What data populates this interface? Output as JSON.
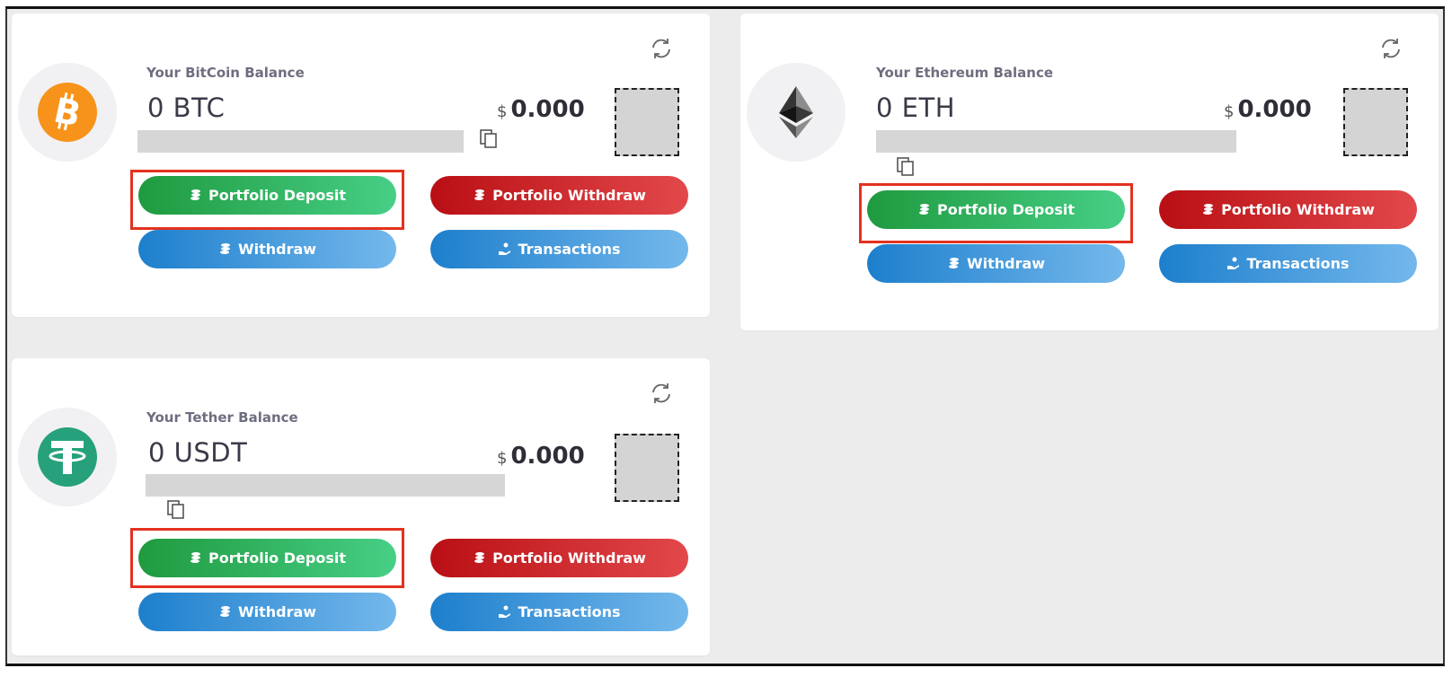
{
  "cards": [
    {
      "coin": "bitcoin",
      "title": "Your BitCoin Balance",
      "amount": "0 BTC",
      "currency_symbol": "$",
      "usd_value": "0.000",
      "logo_color": "#f7931a",
      "buttons": {
        "portfolio_deposit": "Portfolio Deposit",
        "portfolio_withdraw": "Portfolio Withdraw",
        "withdraw": "Withdraw",
        "transactions": "Transactions"
      }
    },
    {
      "coin": "ethereum",
      "title": "Your Ethereum Balance",
      "amount": "0 ETH",
      "currency_symbol": "$",
      "usd_value": "0.000",
      "logo_color": "#3c3c3d",
      "buttons": {
        "portfolio_deposit": "Portfolio Deposit",
        "portfolio_withdraw": "Portfolio Withdraw",
        "withdraw": "Withdraw",
        "transactions": "Transactions"
      }
    },
    {
      "coin": "tether",
      "title": "Your Tether Balance",
      "amount": "0 USDT",
      "currency_symbol": "$",
      "usd_value": "0.000",
      "logo_color": "#26a17b",
      "buttons": {
        "portfolio_deposit": "Portfolio Deposit",
        "portfolio_withdraw": "Portfolio Withdraw",
        "withdraw": "Withdraw",
        "transactions": "Transactions"
      }
    }
  ],
  "icons": {
    "refresh": "refresh-icon",
    "copy": "copy-icon",
    "coins": "coins-icon",
    "hand_coin": "hand-coin-icon"
  },
  "colors": {
    "deposit_green": "#1f9a3f",
    "withdraw_red": "#b90f14",
    "action_blue": "#1d7fcc",
    "highlight_red": "#e3321f",
    "page_background": "#ececec"
  }
}
